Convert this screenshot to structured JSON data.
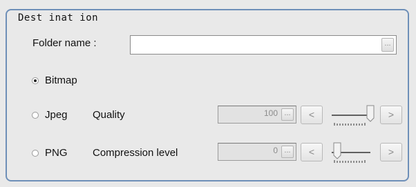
{
  "destination": {
    "legend": "Dest inat ion",
    "folder_label": "Folder name :",
    "folder_value": "",
    "browse_label": "...",
    "formats": [
      {
        "name": "Bitmap",
        "selected": true
      },
      {
        "name": "Jpeg",
        "selected": false,
        "param_label": "Quality",
        "value": "100",
        "dots": "...",
        "dec": "<",
        "inc": ">",
        "slider_level": 1.0
      },
      {
        "name": "PNG",
        "selected": false,
        "param_label": "Compression level",
        "value": "0",
        "dots": "...",
        "dec": "<",
        "inc": ">",
        "slider_level": 0.0
      }
    ]
  },
  "colors": {
    "frame": "#6e8fb8",
    "background": "#e9e9e9"
  }
}
